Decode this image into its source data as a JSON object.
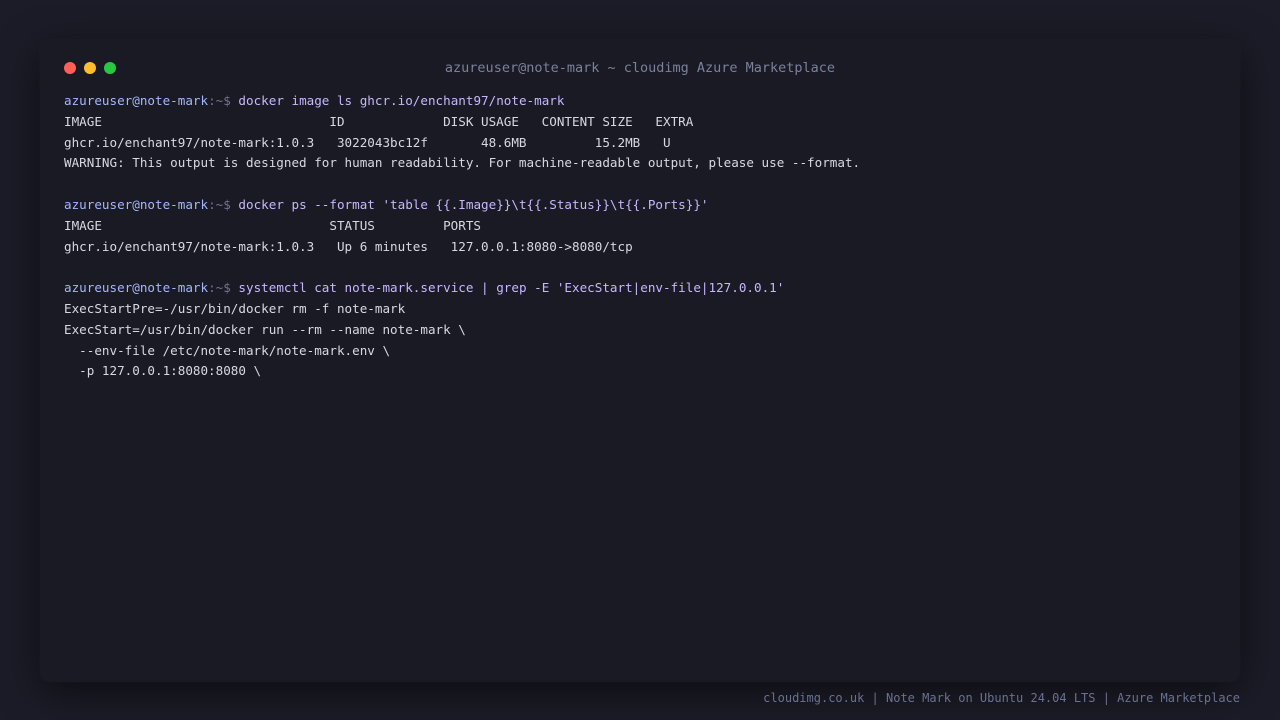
{
  "window": {
    "title": "azureuser@note-mark ~ cloudimg Azure Marketplace"
  },
  "prompt": {
    "user_host": "azureuser@note-mark",
    "suffix": ":~$"
  },
  "sessions": [
    {
      "command": "docker image ls ghcr.io/enchant97/note-mark",
      "output": [
        "IMAGE                              ID             DISK USAGE   CONTENT SIZE   EXTRA",
        "ghcr.io/enchant97/note-mark:1.0.3   3022043bc12f       48.6MB         15.2MB   U",
        "WARNING: This output is designed for human readability. For machine-readable output, please use --format."
      ]
    },
    {
      "command": "docker ps --format 'table {{.Image}}\\t{{.Status}}\\t{{.Ports}}'",
      "output": [
        "IMAGE                              STATUS         PORTS",
        "ghcr.io/enchant97/note-mark:1.0.3   Up 6 minutes   127.0.0.1:8080->8080/tcp"
      ]
    },
    {
      "command": "systemctl cat note-mark.service | grep -E 'ExecStart|env-file|127.0.0.1'",
      "output": [
        "ExecStartPre=-/usr/bin/docker rm -f note-mark",
        "ExecStart=/usr/bin/docker run --rm --name note-mark \\",
        "  --env-file /etc/note-mark/note-mark.env \\",
        "  -p 127.0.0.1:8080:8080 \\"
      ]
    }
  ],
  "footer": {
    "text": "cloudimg.co.uk | Note Mark on Ubuntu 24.04 LTS | Azure Marketplace"
  },
  "colors": {
    "background": "#1b1c27",
    "window": "#191a24",
    "prompt_user": "#a6b5ff",
    "command": "#c8b6ff",
    "output": "#d6d8e2",
    "close": "#ff5f57",
    "minimize": "#febc2e",
    "zoom": "#28c840"
  }
}
